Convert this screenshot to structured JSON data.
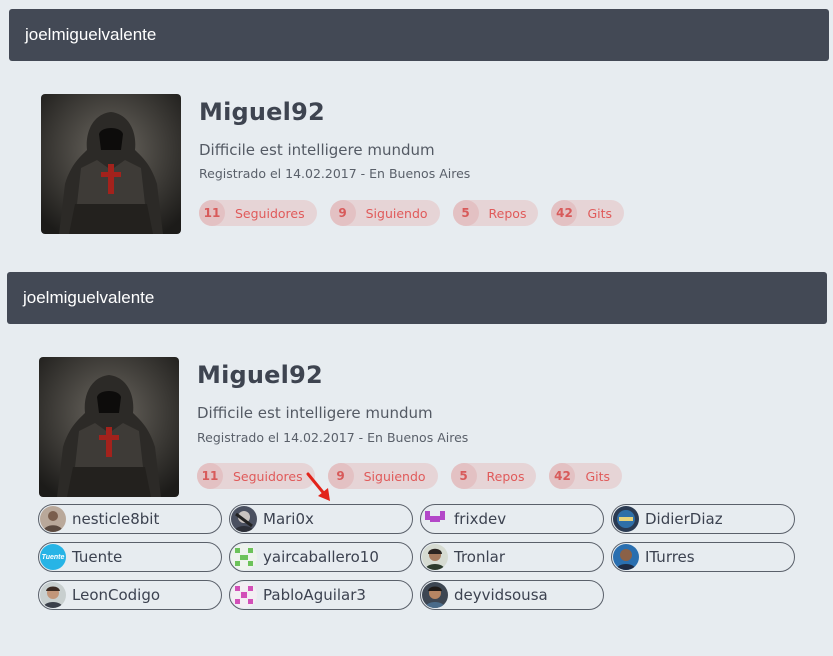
{
  "panels": [
    {
      "header": "joelmiguelvalente",
      "name": "Miguel92",
      "bio": "Difficile est intelligere mundum",
      "meta": "Registrado el 14.02.2017 - En Buenos Aires",
      "stats": [
        {
          "count": "11",
          "label": "Seguidores"
        },
        {
          "count": "9",
          "label": "Siguiendo"
        },
        {
          "count": "5",
          "label": "Repos"
        },
        {
          "count": "42",
          "label": "Gits"
        }
      ]
    },
    {
      "header": "joelmiguelvalente",
      "name": "Miguel92",
      "bio": "Difficile est intelligere mundum",
      "meta": "Registrado el 14.02.2017 - En Buenos Aires",
      "stats": [
        {
          "count": "11",
          "label": "Seguidores"
        },
        {
          "count": "9",
          "label": "Siguiendo"
        },
        {
          "count": "5",
          "label": "Repos"
        },
        {
          "count": "42",
          "label": "Gits"
        }
      ]
    }
  ],
  "followers": [
    {
      "name": "nesticle8bit"
    },
    {
      "name": "Mari0x"
    },
    {
      "name": "frixdev"
    },
    {
      "name": "DidierDiaz"
    },
    {
      "name": "Tuente",
      "badge": "Tuente"
    },
    {
      "name": "yaircaballero10"
    },
    {
      "name": "Tronlar"
    },
    {
      "name": "ITurres"
    },
    {
      "name": "LeonCodigo"
    },
    {
      "name": "PabloAguilar3"
    },
    {
      "name": "deyvidsousa"
    }
  ],
  "colors": {
    "header": "#434955",
    "accent": "#e05a5a",
    "page": "#e7ecf0"
  }
}
